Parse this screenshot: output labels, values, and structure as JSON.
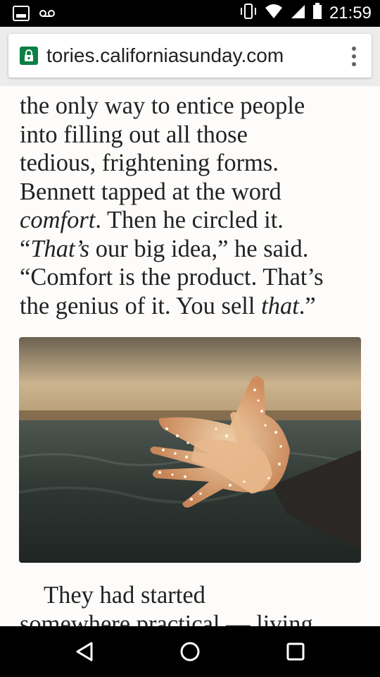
{
  "status": {
    "time": "21:59",
    "icons": [
      "voicemail-icon",
      "vibrate-icon",
      "wifi-icon",
      "signal-icon",
      "battery-icon"
    ]
  },
  "browser": {
    "url": "tories.californiasunday.com",
    "lock_color": "#0b8043"
  },
  "article": {
    "paragraph_before_lines": [
      "the only way to entice people",
      "into filling out all those",
      "tedious, frightening forms.",
      "Bennett tapped at the word",
      "comfort. Then he circled it.",
      "“That’s our big idea,” he said.",
      "“Comfort is the product. That’s",
      "the genius of it. You sell that.”"
    ],
    "image": {
      "description": "hands-with-lights-photo"
    },
    "paragraph_after_lines": [
      "They had started",
      "somewhere practical — living"
    ]
  },
  "navigation": {
    "back": "back-icon",
    "home": "home-icon",
    "recents": "recents-icon"
  }
}
